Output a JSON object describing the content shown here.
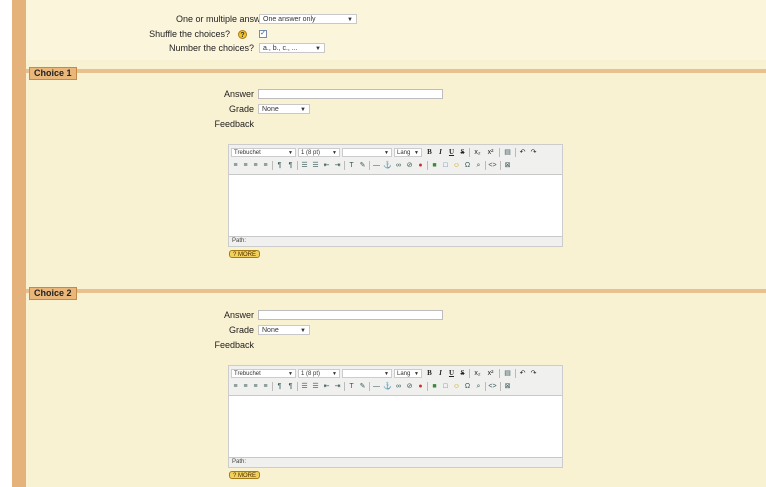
{
  "top_settings": {
    "single_label": "One or multiple answers?",
    "single_value": "One answer only",
    "shuffle_label": "Shuffle the choices?",
    "shuffle_checked": true,
    "shuffle_check_glyph": "✓",
    "number_label": "Number the choices?",
    "number_value": "a., b., c., ..."
  },
  "editor_toolbar": {
    "font": "Trebuchet",
    "size": "1 (8 pt)",
    "style": "",
    "lang": "Lang",
    "bold": "B",
    "italic": "I",
    "underline": "U",
    "strike": "S",
    "subscript": "x₂",
    "superscript": "x²",
    "undo": "↶",
    "redo": "↷",
    "path_label": "Path:",
    "help_label": "? MORE",
    "help_glyph": "?",
    "arrow": "▼"
  },
  "choices": [
    {
      "legend": "Choice 1",
      "answer_label": "Answer",
      "answer_value": "",
      "grade_label": "Grade",
      "grade_value": "None",
      "feedback_label": "Feedback"
    },
    {
      "legend": "Choice 2",
      "answer_label": "Answer",
      "answer_value": "",
      "grade_label": "Grade",
      "grade_value": "None",
      "feedback_label": "Feedback"
    }
  ],
  "colors": {
    "page_background": "#f8f1d2",
    "left_strip": "#e4b27a",
    "legend_background": "#e9b77a",
    "divider": "#e9c18c"
  },
  "icons": [
    "help-icon",
    "align-left-icon",
    "align-center-icon",
    "align-right-icon",
    "justify-icon",
    "ltr-icon",
    "rtl-icon",
    "ordered-list-icon",
    "unordered-list-icon",
    "outdent-icon",
    "indent-icon",
    "text-color-icon",
    "background-color-icon",
    "horizontal-rule-icon",
    "anchor-icon",
    "link-icon",
    "unlink-icon",
    "nolink-icon",
    "image-icon",
    "table-icon",
    "smiley-icon",
    "special-char-icon",
    "search-replace-icon",
    "html-source-icon",
    "fullscreen-icon"
  ]
}
